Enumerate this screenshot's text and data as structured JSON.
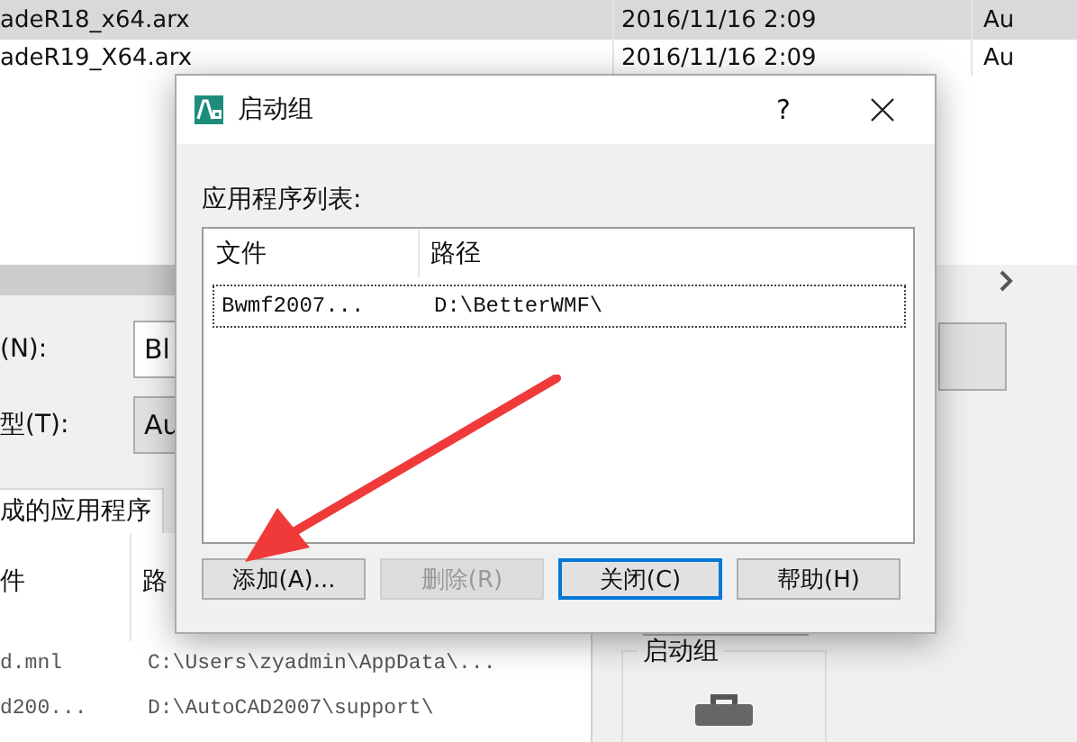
{
  "background_window": {
    "file_list": {
      "rows": [
        {
          "name": "adeR18_x64.arx",
          "date": "2016/11/16 2:09",
          "column_3": "Au",
          "selected": true
        },
        {
          "name": "adeR19_X64.arx",
          "date": "2016/11/16 2:09",
          "column_3": "Au",
          "selected": false
        }
      ]
    },
    "name_label": "(N):",
    "name_field": {
      "value": "Bl"
    },
    "type_label": "型(T):",
    "type_field": {
      "value": "Au"
    },
    "tab": {
      "label": "成的应用程序",
      "selected": true
    },
    "app_list": {
      "columns": [
        "件",
        "路"
      ],
      "rows": [
        {
          "file": "d.mnl",
          "path": "C:\\Users\\zyadmin\\AppData\\..."
        },
        {
          "file": "d200...",
          "path": "D:\\AutoCAD2007\\support\\"
        }
      ]
    },
    "group_box": {
      "title": "启动组"
    }
  },
  "dialog": {
    "title": "启动组",
    "help": "?",
    "list_label": "应用程序列表:",
    "list": {
      "columns": [
        "文件",
        "路径"
      ],
      "rows": [
        {
          "file": "Bwmf2007...",
          "path": "D:\\BetterWMF\\",
          "focused": true
        }
      ]
    },
    "buttons": [
      {
        "label": "添加(A)...",
        "disabled": false,
        "focused": false
      },
      {
        "label": "删除(R)",
        "disabled": true,
        "focused": false
      },
      {
        "label": "关闭(C)",
        "disabled": false,
        "focused": true
      },
      {
        "label": "帮助(H)",
        "disabled": false,
        "focused": false
      }
    ]
  }
}
